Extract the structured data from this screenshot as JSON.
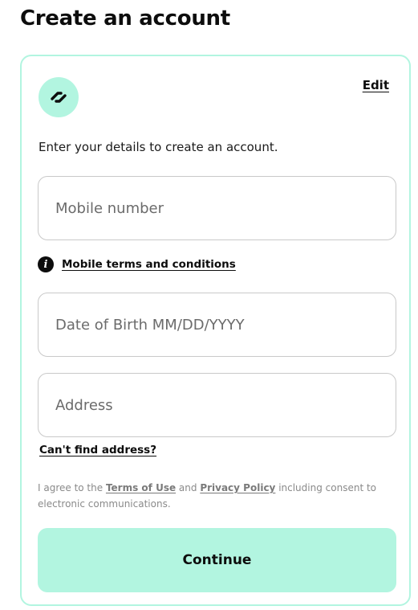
{
  "page": {
    "title": "Create an account"
  },
  "card": {
    "logo_icon": "link-chain-icon",
    "edit_label": "Edit",
    "intro_text": "Enter your details to create an account."
  },
  "form": {
    "mobile_placeholder": "Mobile number",
    "mobile_terms_icon": "info-icon",
    "mobile_terms_label": "Mobile terms and conditions",
    "dob_placeholder": "Date of Birth MM/DD/YYYY",
    "address_placeholder": "Address",
    "cant_find_address_label": "Can't find address?"
  },
  "consent": {
    "prefix": "I agree to the ",
    "terms_link": "Terms of Use",
    "middle": " and ",
    "privacy_link": "Privacy Policy",
    "suffix": " including consent to electronic communications."
  },
  "actions": {
    "continue_label": "Continue"
  },
  "colors": {
    "accent": "#b2f5e0",
    "text": "#0d0d0d",
    "placeholder": "#6b6b6b",
    "border": "#c9c9c9"
  }
}
